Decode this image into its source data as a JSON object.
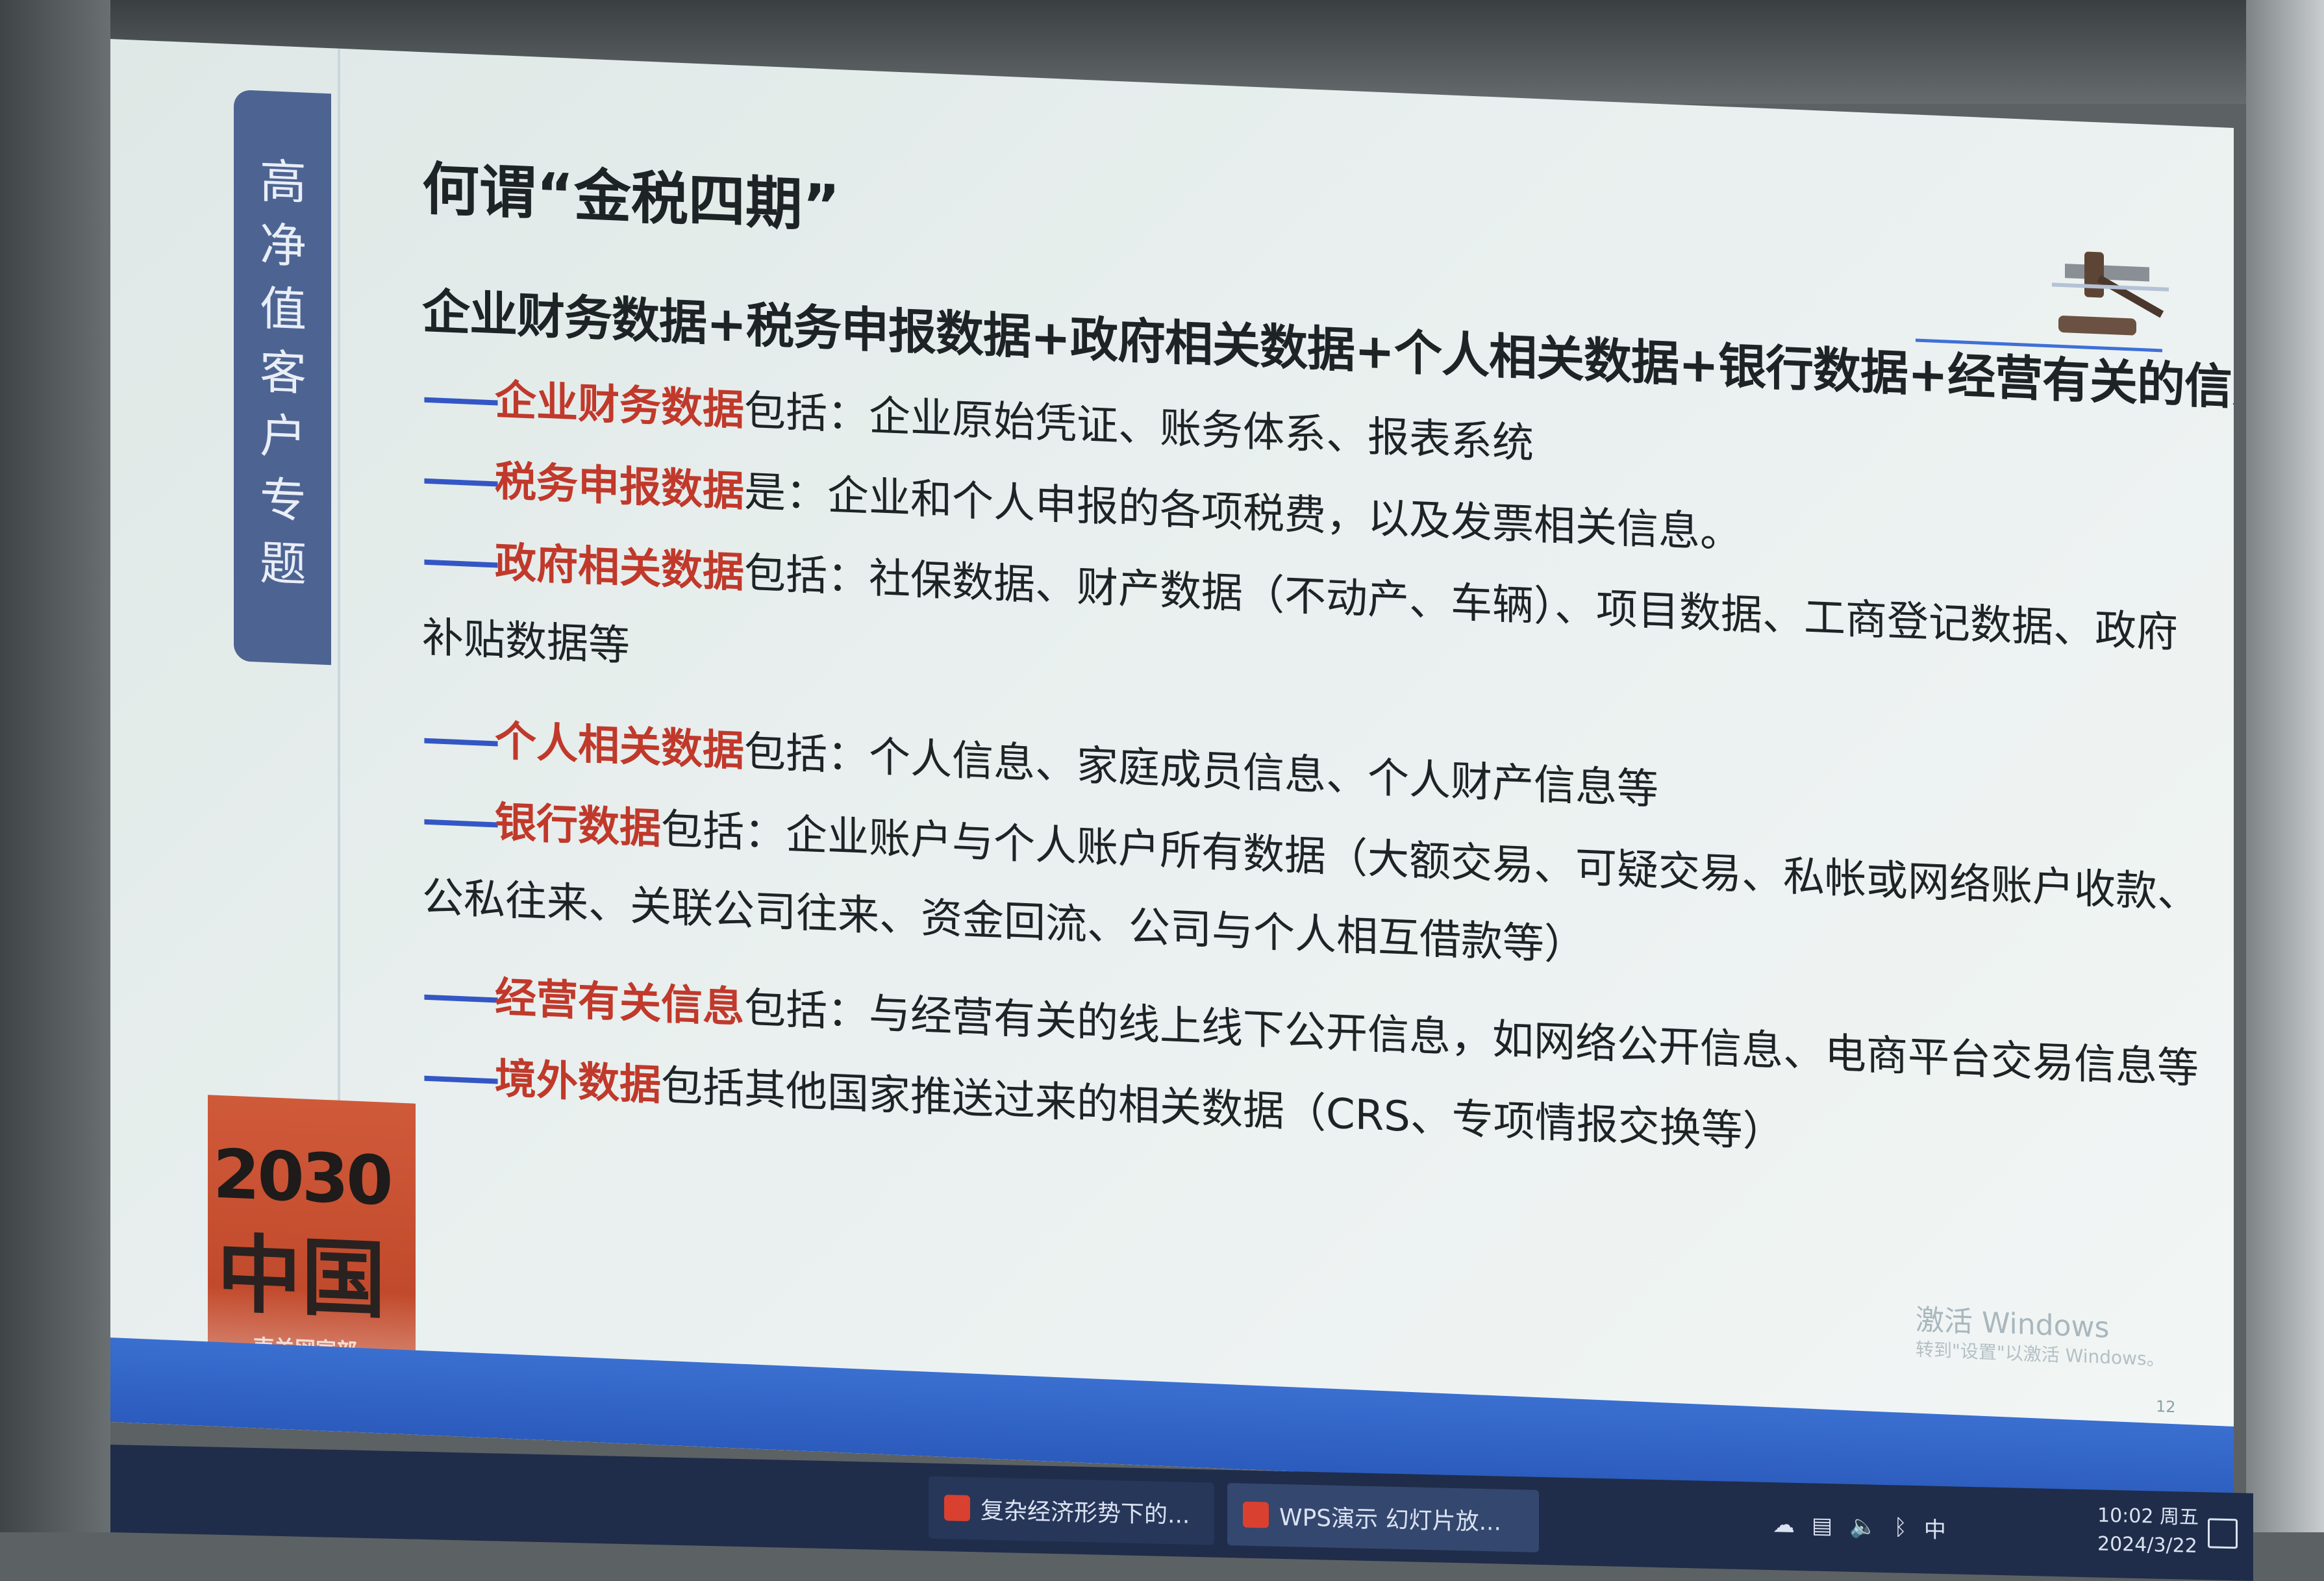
{
  "sidebar": {
    "title": "高净值客户专题"
  },
  "badge": {
    "year": "2030",
    "text": "中国",
    "sub": "南关网宣部"
  },
  "slide": {
    "title": "何谓“金税四期”",
    "formula": "企业财务数据+税务申报数据+政府相关数据+个人相关数据+银行数据+经营有关的信息",
    "dash": "——",
    "items": [
      {
        "highlight": "企业财务数据",
        "text": "包括：企业原始凭证、账务体系、报表系统"
      },
      {
        "highlight": "税务申报数据",
        "text": "是：企业和个人申报的各项税费，以及发票相关信息。"
      },
      {
        "highlight": "政府相关数据",
        "text": "包括：社保数据、财产数据（不动产、车辆）、项目数据、工商登记数据、政府",
        "continuation": "补贴数据等"
      },
      {
        "highlight": "个人相关数据",
        "text": "包括：个人信息、家庭成员信息、个人财产信息等"
      },
      {
        "highlight": "银行数据",
        "text": "包括：企业账户与个人账户所有数据（大额交易、可疑交易、私帐或网络账户收款、",
        "continuation": "公私往来、关联公司往来、资金回流、公司与个人相互借款等）"
      },
      {
        "highlight": "经营有关信息",
        "text": "包括：与经营有关的线上线下公开信息，如网络公开信息、电商平台交易信息等"
      },
      {
        "highlight": "境外数据",
        "text": "包括其他国家推送过来的相关数据（CRS、专项情报交换等）"
      }
    ],
    "watermark": {
      "line1": "激活 Windows",
      "line2": "转到\"设置\"以激活 Windows。"
    },
    "page_number": "12"
  },
  "taskbar": {
    "buttons": [
      {
        "label": "复杂经济形势下的..."
      },
      {
        "label": "WPS演示 幻灯片放..."
      }
    ],
    "tray": {
      "ime": "中"
    },
    "clock": {
      "time": "10:02 周五",
      "date": "2024/3/22"
    }
  }
}
